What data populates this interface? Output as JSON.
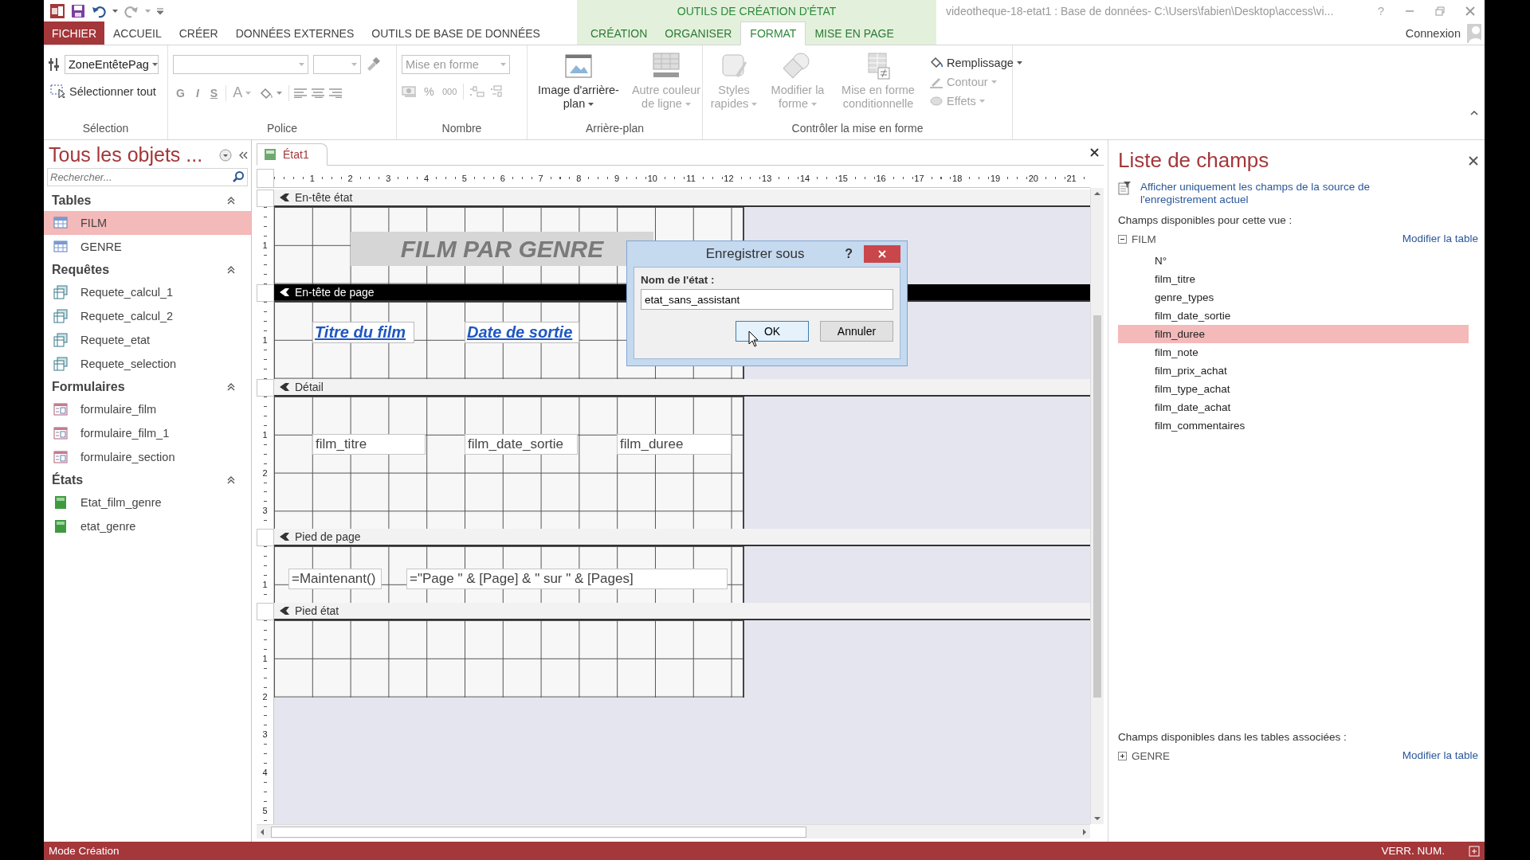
{
  "title_bar": {
    "context_group": "OUTILS DE CRÉATION D'ÉTAT",
    "title": "videotheque-18-etat1 : Base de données- C:\\Users\\fabien\\Desktop\\access\\vi...",
    "help": "?"
  },
  "ribbon_tabs": [
    {
      "label": "FICHIER",
      "kind": "file",
      "selected": false
    },
    {
      "label": "ACCUEIL",
      "kind": "standard",
      "selected": false
    },
    {
      "label": "CRÉER",
      "kind": "standard",
      "selected": false
    },
    {
      "label": "DONNÉES EXTERNES",
      "kind": "standard",
      "selected": false
    },
    {
      "label": "OUTILS DE BASE DE DONNÉES",
      "kind": "standard",
      "selected": false
    },
    {
      "label": "CRÉATION",
      "kind": "contextual",
      "selected": false
    },
    {
      "label": "ORGANISER",
      "kind": "contextual",
      "selected": false
    },
    {
      "label": "FORMAT",
      "kind": "contextual",
      "selected": true
    },
    {
      "label": "MISE EN PAGE",
      "kind": "contextual",
      "selected": false
    }
  ],
  "account": "Connexion",
  "ribbon": {
    "selection": {
      "label": "Sélection",
      "object": "ZoneEntêtePag",
      "select_all": "Sélectionner tout"
    },
    "police": {
      "label": "Police",
      "styles": [
        "G",
        "I",
        "S"
      ],
      "font_color": "A"
    },
    "nombre": {
      "label": "Nombre",
      "format": "Mise en forme",
      "percent": "%",
      "thousands": "000"
    },
    "arriere_plan": {
      "label": "Arrière-plan",
      "buttons": [
        {
          "label": "Image d'arrière-plan",
          "kind": "image",
          "disabled": false,
          "dropdown": true
        },
        {
          "label": "Autre couleur de ligne",
          "kind": "line",
          "disabled": true,
          "dropdown": true
        }
      ]
    },
    "controle": {
      "label": "Contrôler la mise en forme",
      "buttons": [
        {
          "label": "Styles rapides",
          "kind": "styles",
          "disabled": true,
          "dropdown": true
        },
        {
          "label": "Modifier la forme",
          "kind": "shape",
          "disabled": true,
          "dropdown": true
        },
        {
          "label": "Mise en forme conditionnelle",
          "kind": "conditional",
          "disabled": true,
          "dropdown": false
        }
      ],
      "small_buttons": [
        {
          "label": "Remplissage",
          "kind": "fill",
          "disabled": false
        },
        {
          "label": "Contour",
          "kind": "outline",
          "disabled": true
        },
        {
          "label": "Effets",
          "kind": "effects",
          "disabled": true
        }
      ]
    }
  },
  "navigation": {
    "title": "Tous les objets ...",
    "search_placeholder": "Rechercher...",
    "groups": [
      {
        "label": "Tables",
        "kind": "table",
        "items": [
          {
            "label": "FILM",
            "selected": true
          },
          {
            "label": "GENRE",
            "selected": false
          }
        ]
      },
      {
        "label": "Requêtes",
        "kind": "query",
        "items": [
          {
            "label": "Requete_calcul_1",
            "selected": false
          },
          {
            "label": "Requete_calcul_2",
            "selected": false
          },
          {
            "label": "Requete_etat",
            "selected": false
          },
          {
            "label": "Requete_selection",
            "selected": false
          }
        ]
      },
      {
        "label": "Formulaires",
        "kind": "form",
        "items": [
          {
            "label": "formulaire_film",
            "selected": false
          },
          {
            "label": "formulaire_film_1",
            "selected": false
          },
          {
            "label": "formulaire_section",
            "selected": false
          }
        ]
      },
      {
        "label": "États",
        "kind": "report",
        "items": [
          {
            "label": "Etat_film_genre",
            "selected": false
          },
          {
            "label": "etat_genre",
            "selected": false
          }
        ]
      }
    ]
  },
  "document": {
    "tab": "État1",
    "ruler": [
      "1",
      "2",
      "3",
      "4",
      "5",
      "6",
      "7",
      "8",
      "9",
      "10",
      "11",
      "12",
      "13",
      "14",
      "15",
      "16",
      "17",
      "18",
      "19",
      "20",
      "21"
    ],
    "sections": [
      {
        "kind": "report_header",
        "title": "En-tête état",
        "selected": false,
        "ruler": [
          "1"
        ],
        "controls": [
          {
            "kind": "title",
            "text": "FILM PAR GENRE"
          }
        ]
      },
      {
        "kind": "page_header",
        "title": "En-tête de page",
        "selected": true,
        "ruler": [
          "1"
        ],
        "controls": [
          {
            "kind": "label",
            "text": "Titre du film"
          },
          {
            "kind": "label",
            "text": "Date de sortie"
          }
        ]
      },
      {
        "kind": "detail",
        "title": "Détail",
        "selected": false,
        "ruler": [
          "1",
          "2",
          "3"
        ],
        "controls": [
          {
            "kind": "field",
            "text": "film_titre"
          },
          {
            "kind": "field",
            "text": "film_date_sortie"
          },
          {
            "kind": "field",
            "text": "film_duree"
          }
        ]
      },
      {
        "kind": "page_footer",
        "title": "Pied de page",
        "selected": false,
        "ruler": [
          "1"
        ],
        "controls": [
          {
            "kind": "field",
            "text": "=Maintenant()"
          },
          {
            "kind": "field",
            "text": "=\"Page \" & [Page] & \" sur \" & [Pages]"
          }
        ]
      },
      {
        "kind": "report_footer",
        "title": "Pied état",
        "selected": false,
        "ruler": [
          "1",
          "2",
          "3",
          "4",
          "5"
        ]
      }
    ]
  },
  "dialog": {
    "title": "Enregistrer sous",
    "help": "?",
    "field_label": "Nom de l'état :",
    "value": "etat_sans_assistant",
    "buttons": [
      {
        "label": "OK",
        "default": true
      },
      {
        "label": "Annuler",
        "default": false
      }
    ]
  },
  "field_list": {
    "title": "Liste de champs",
    "filter_link": "Afficher uniquement les champs de la source de l'enregistrement actuel",
    "available_label": "Champs disponibles pour cette vue :",
    "tables": [
      {
        "name": "FILM",
        "expanded": true,
        "edit_link": "Modifier la table",
        "fields": [
          {
            "label": "N°",
            "selected": false
          },
          {
            "label": "film_titre",
            "selected": false
          },
          {
            "label": "genre_types",
            "selected": false
          },
          {
            "label": "film_date_sortie",
            "selected": false
          },
          {
            "label": "film_duree",
            "selected": true
          },
          {
            "label": "film_note",
            "selected": false
          },
          {
            "label": "film_prix_achat",
            "selected": false
          },
          {
            "label": "film_type_achat",
            "selected": false
          },
          {
            "label": "film_date_achat",
            "selected": false
          },
          {
            "label": "film_commentaires",
            "selected": false
          }
        ]
      }
    ],
    "related_label": "Champs disponibles dans les tables associées :",
    "related_tables": [
      {
        "name": "GENRE",
        "expanded": false,
        "edit_link": "Modifier la table"
      }
    ]
  },
  "status_bar": {
    "mode": "Mode Création",
    "indicator": "VERR. NUM."
  }
}
